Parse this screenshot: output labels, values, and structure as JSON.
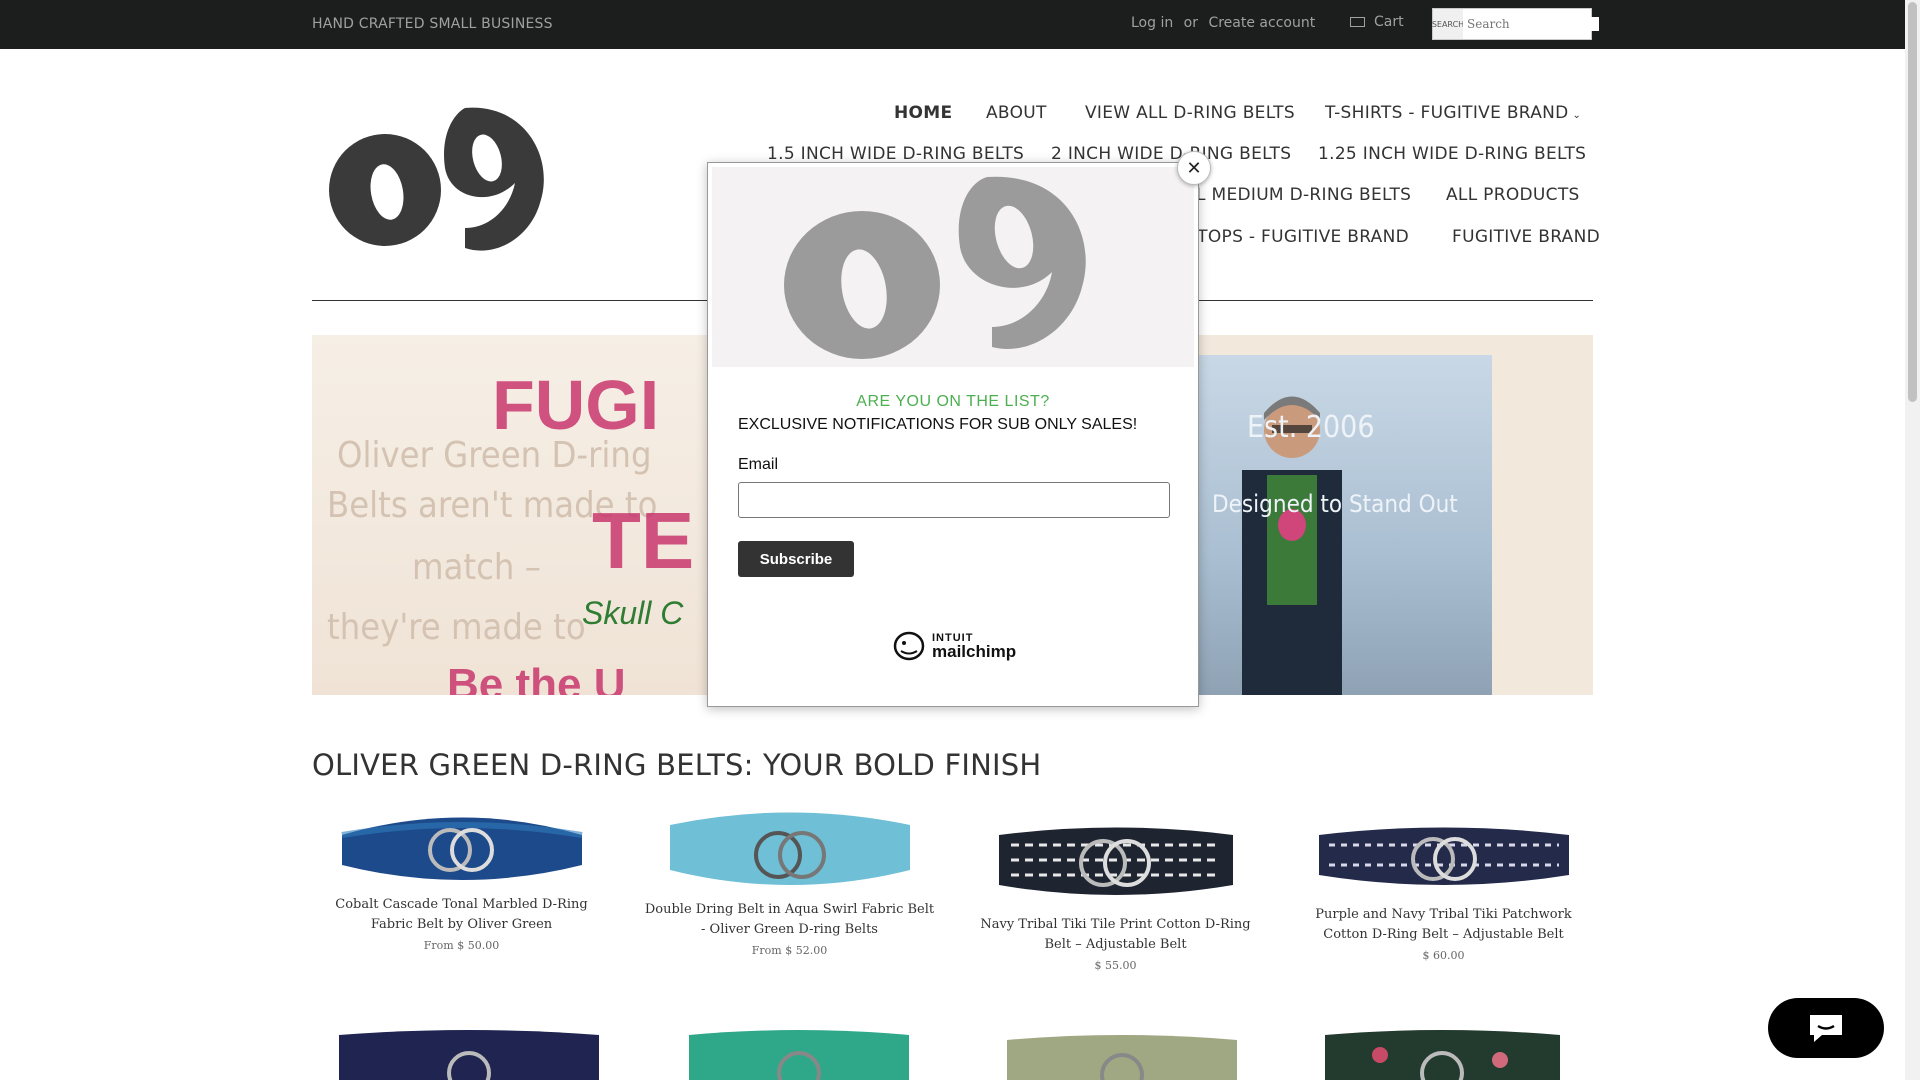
{
  "topbar": {
    "tagline": "HAND CRAFTED SMALL BUSINESS",
    "login": "Log in",
    "or": "or",
    "create_account": "Create account",
    "cart": "Cart",
    "search_placeholder": "Search",
    "search_button": "SEARCH"
  },
  "nav": {
    "items": [
      "HOME",
      "ABOUT",
      "VIEW ALL D-RING BELTS",
      "T-SHIRTS - FUGITIVE BRAND",
      "1.5 INCH WIDE D-RING BELTS",
      "2 INCH WIDE D-RING BELTS",
      "1.25 INCH WIDE D-RING BELTS",
      "L MEDIUM D-RING BELTS",
      "ALL PRODUCTS",
      "K TOPS - FUGITIVE BRAND",
      "FUGITIVE BRAND"
    ],
    "logo_text": "og"
  },
  "hero": {
    "line1": "Oliver Green D-ring",
    "line2": "Belts aren't made to",
    "line3": "match –",
    "line4": "they're made to",
    "line5": "Be the U",
    "fugitive": "FUGI",
    "tee": "TE",
    "skull": "Skull C",
    "right1": "Est. 2006",
    "right2": "Designed to Stand Out"
  },
  "section": {
    "title": "OLIVER GREEN D-RING BELTS: YOUR BOLD FINISH"
  },
  "products": [
    {
      "name": "Cobalt Cascade Tonal Marbled D-Ring Fabric Belt by Oliver Green",
      "price": "From $ 50.00",
      "color": "#1d4a8a"
    },
    {
      "name": "Double Dring Belt in Aqua Swirl Fabric Belt - Oliver Green D-ring Belts",
      "price": "From $ 52.00",
      "color": "#6fbfd6"
    },
    {
      "name": "Navy Tribal Tiki Tile Print Cotton D-Ring Belt – Adjustable Belt",
      "price": "$ 55.00",
      "color": "#1e2430"
    },
    {
      "name": "Purple and Navy Tribal Tiki Patchwork Cotton D-Ring Belt – Adjustable Belt",
      "price": "$ 60.00",
      "color": "#242a4a"
    }
  ],
  "popup": {
    "close_symbol": "✕",
    "heading": "ARE YOU ON THE LIST?",
    "subheading": "EXCLUSIVE NOTIFICATIONS FOR SUB ONLY SALES!",
    "email_label": "Email",
    "email_value": "",
    "subscribe": "Subscribe",
    "brand_line1": "INTUIT",
    "brand_line2": "mailchimp"
  },
  "chat": {
    "icon": "chat-bubble-icon"
  }
}
